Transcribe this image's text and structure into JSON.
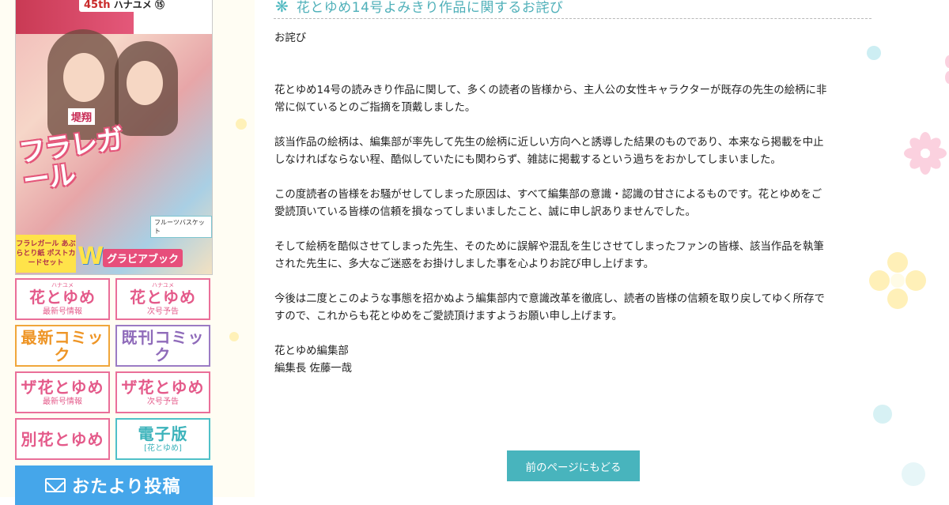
{
  "sidebar": {
    "cover": {
      "issue_label": "45th",
      "magazine_name": "ハナユメ",
      "issue_number": "⑮",
      "author": "堤翔",
      "headline": "フラレガール",
      "badge_text": "フラレガール あぶらとり紙 ポストカードセット",
      "w_mark": "W",
      "gravure_label": "グラビアブック",
      "furu_label": "フルーツバスケット"
    },
    "nav": [
      {
        "main": "花とゆめ",
        "furigana": "ハナユメ",
        "sub": "最新号情報",
        "style": "pink"
      },
      {
        "main": "花とゆめ",
        "furigana": "ハナユメ",
        "sub": "次号予告",
        "style": "pink"
      },
      {
        "main": "最新コミック",
        "furigana": "",
        "sub": "",
        "style": "orange"
      },
      {
        "main": "既刊コミック",
        "furigana": "",
        "sub": "",
        "style": "purple"
      },
      {
        "main": "ザ花とゆめ",
        "furigana": "",
        "sub": "最新号情報",
        "style": "pink"
      },
      {
        "main": "ザ花とゆめ",
        "furigana": "",
        "sub": "次号予告",
        "style": "pink"
      },
      {
        "main": "別花とゆめ",
        "furigana": "",
        "sub": "",
        "style": "pink"
      },
      {
        "main": "電子版",
        "furigana": "",
        "sub": "[花とゆめ]",
        "style": "teal"
      }
    ],
    "post_button": "おたより投稿"
  },
  "main": {
    "title": "花とゆめ14号よみきり作品に関するお詫び",
    "heading": "お詫び",
    "paragraphs": [
      [
        "花とゆめ14号の読みきり作品に関して、多くの読者の皆様から、主人公の女性キャラクターが既存の先生の絵柄に非",
        "常に似ているとのご指摘を頂戴しました。"
      ],
      [
        "該当作品の絵柄は、編集部が率先して先生の絵柄に近しい方向へと誘導した結果のものであり、本来なら掲載を中止",
        "しなければならない程、酷似していたにも関わらず、雑誌に掲載するという過ちをおかしてしまいました。"
      ],
      [
        "この度読者の皆様をお騒がせしてしまった原因は、すべて編集部の意識・認識の甘さによるものです。花とゆめをご",
        "愛読頂いている皆様の信頼を損なってしまいましたこと、誠に申し訳ありませんでした。"
      ],
      [
        "そして絵柄を酷似させてしまった先生、そのために誤解や混乱を生じさせてしまったファンの皆様、該当作品を執筆",
        "された先生に、多大なご迷惑をお掛けしました事を心よりお詫び申し上げます。"
      ],
      [
        "今後は二度とこのような事態を招かぬよう編集部内で意識改革を徹底し、読者の皆様の信頼を取り戻してゆく所存で",
        "すので、これからも花とゆめをご愛読頂けますようお願い申し上げます。"
      ]
    ],
    "signature": [
      "花とゆめ編集部",
      "編集長 佐藤一哉"
    ],
    "back_button": "前のページにもどる"
  },
  "colors": {
    "accent_teal": "#48b4bd",
    "title_teal": "#4fb0b9",
    "post_blue": "#45a6ea",
    "pink": "#ea6f99"
  }
}
